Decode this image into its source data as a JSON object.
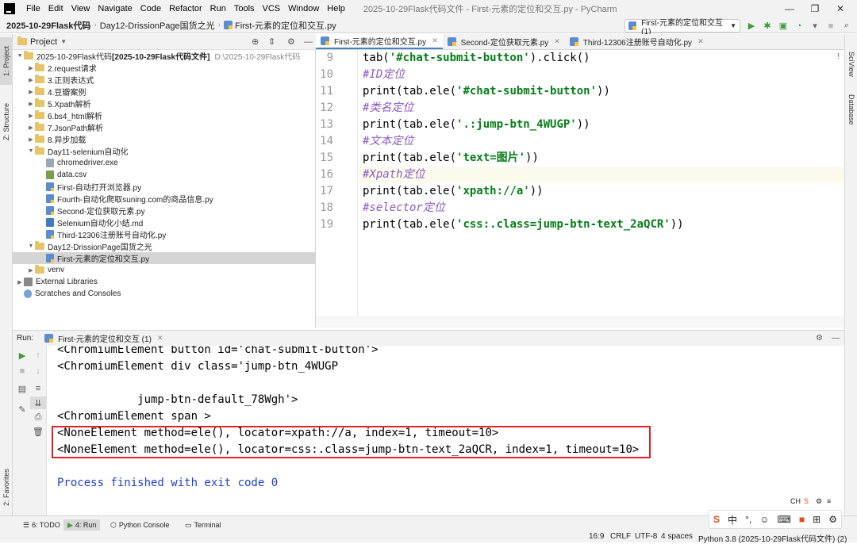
{
  "menubar": {
    "items": [
      "File",
      "Edit",
      "View",
      "Navigate",
      "Code",
      "Refactor",
      "Run",
      "Tools",
      "VCS",
      "Window",
      "Help"
    ],
    "title": "2025-10-29Flask代码文件 - First-元素的定位和交互.py - PyCharm"
  },
  "navbar": {
    "crumbs": [
      "2025-10-29Flask代码",
      "Day12-DrissionPage国货之光",
      "First-元素的定位和交互.py"
    ]
  },
  "run_config": {
    "label": "First-元素的定位和交互 (1)"
  },
  "left_stripe": {
    "project": "1: Project",
    "structure": "Z: Structure",
    "favorites": "2: Favorites"
  },
  "right_stripe": {
    "sciview": "SciView",
    "database": "Database"
  },
  "project_panel": {
    "title": "Project"
  },
  "tree": [
    {
      "label": "2025-10-29Flask代码",
      "bold": " [2025-10-29Flask代码文件]",
      "extra": "D:\\2025-10-29Flask代码",
      "kind": "folder",
      "arrow": "▼"
    },
    {
      "label": "2.request请求",
      "kind": "folder",
      "arrow": "▶"
    },
    {
      "label": "3.正则表达式",
      "kind": "folder",
      "arrow": "▶"
    },
    {
      "label": "4.豆瓣案例",
      "kind": "folder",
      "arrow": "▶"
    },
    {
      "label": "5.Xpath解析",
      "kind": "folder",
      "arrow": "▶"
    },
    {
      "label": "6.bs4_html解析",
      "kind": "folder",
      "arrow": "▶"
    },
    {
      "label": "7.JsonPath解析",
      "kind": "folder",
      "arrow": "▶"
    },
    {
      "label": "8.异步加载",
      "kind": "folder",
      "arrow": "▶"
    },
    {
      "label": "Day11-selenium自动化",
      "kind": "folder",
      "arrow": "▼"
    },
    {
      "label": "chromedriver.exe",
      "kind": "exe",
      "arrow": ""
    },
    {
      "label": "data.csv",
      "kind": "csv",
      "arrow": ""
    },
    {
      "label": "First-自动打开浏览器.py",
      "kind": "py",
      "arrow": ""
    },
    {
      "label": "Fourth-自动化爬取suning.com的商品信息.py",
      "kind": "py",
      "arrow": ""
    },
    {
      "label": "Second-定位获取元素.py",
      "kind": "py",
      "arrow": ""
    },
    {
      "label": "Selenium自动化小结.md",
      "kind": "md",
      "arrow": ""
    },
    {
      "label": "Third-12306注册账号自动化.py",
      "kind": "py",
      "arrow": ""
    },
    {
      "label": "Day12-DrissionPage国货之光",
      "kind": "folder",
      "arrow": "▼"
    },
    {
      "label": "First-元素的定位和交互.py",
      "kind": "py",
      "arrow": "",
      "selected": true
    },
    {
      "label": "venv",
      "kind": "folder",
      "arrow": "▶"
    },
    {
      "label": "External Libraries",
      "kind": "lib",
      "arrow": "▶"
    },
    {
      "label": "Scratches and Consoles",
      "kind": "scr",
      "arrow": ""
    }
  ],
  "editor_tabs": [
    {
      "label": "First-元素的定位和交互.py",
      "active": true
    },
    {
      "label": "Second-定位获取元素.py"
    },
    {
      "label": "Third-12306注册账号自动化.py"
    }
  ],
  "code": {
    "line_numbers": [
      "9",
      "10",
      "11",
      "12",
      "13",
      "14",
      "15",
      "16",
      "17",
      "18",
      "19"
    ],
    "lines": [
      {
        "type": "mixed",
        "pre": "tab(",
        "str": "'#chat-submit-button'",
        "post": ").click()"
      },
      {
        "type": "comment",
        "text": "#ID定位"
      },
      {
        "type": "mixed",
        "pre": "print(tab.ele(",
        "str": "'#chat-submit-button'",
        "post": "))"
      },
      {
        "type": "comment",
        "text": "#类名定位"
      },
      {
        "type": "mixed",
        "pre": "print(tab.ele(",
        "str": "'.:jump-btn_4WUGP'",
        "post": "))"
      },
      {
        "type": "comment",
        "text": "#文本定位"
      },
      {
        "type": "mixed",
        "pre": "print(tab.ele(",
        "str": "'text=图片'",
        "post": "))"
      },
      {
        "type": "comment",
        "text": "#Xpath定位"
      },
      {
        "type": "mixed",
        "pre": "print(tab.ele(",
        "str": "'xpath://a'",
        "post": "))"
      },
      {
        "type": "comment",
        "text": "#selector定位"
      },
      {
        "type": "mixed",
        "pre": "print(tab.ele(",
        "str": "'css:.class=jump-btn-text_2aQCR'",
        "post": "))"
      }
    ]
  },
  "run_panel": {
    "label": "Run:",
    "tab": "First-元素的定位和交互 (1)"
  },
  "console": {
    "lines": [
      "<ChromiumElement button id='chat-submit-button'>",
      "<ChromiumElement div class='jump-btn_4WUGP",
      "",
      "            jump-btn-default_78Wgh'>",
      "<ChromiumElement span >",
      "<NoneElement method=ele(), locator=xpath://a, index=1, timeout=10>",
      "<NoneElement method=ele(), locator=css:.class=jump-btn-text_2aQCR, index=1, timeout=10>",
      "",
      "Process finished with exit code 0"
    ]
  },
  "statusbar": {
    "todo": "6: TODO",
    "run": "4: Run",
    "python_console": "Python Console",
    "terminal": "Terminal",
    "position": "16:9",
    "line_sep": "CRLF",
    "encoding": "UTF-8",
    "indent": "4 spaces",
    "interpreter": "Python 3.8 (2025-10-29Flask代码文件) (2)"
  },
  "ime": {
    "labels": [
      "S",
      "中",
      "°,",
      "☺",
      "⌨",
      "■",
      "⊞",
      "⚙"
    ],
    "mini": "CH"
  },
  "colors": {
    "accent": "#4083c9",
    "run_green": "#3c9a3c",
    "highlight_box": "#e0232b",
    "string": "#067d17",
    "comment": "#8c5bc0"
  }
}
